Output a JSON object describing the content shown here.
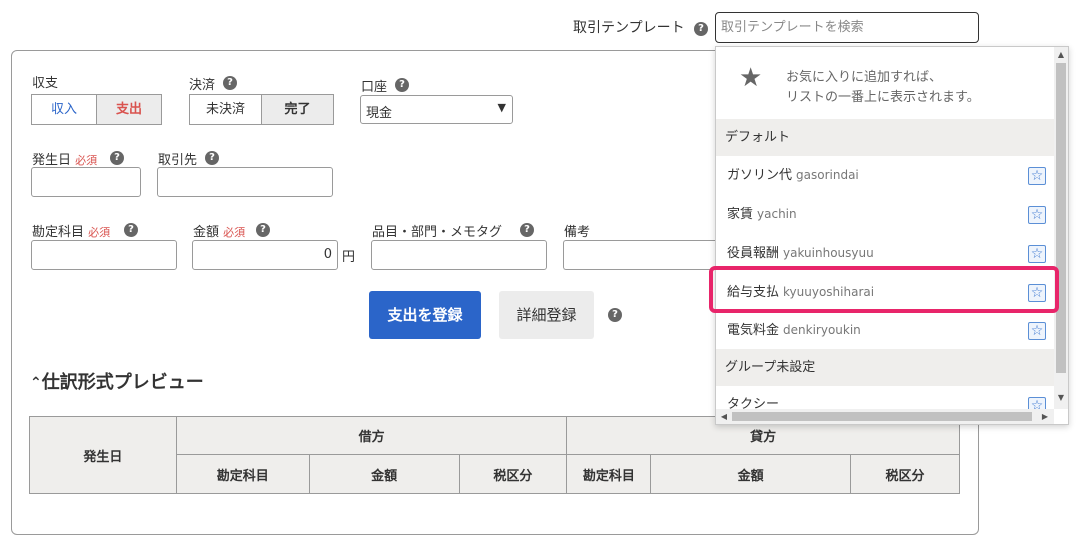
{
  "template": {
    "label": "取引テンプレート",
    "search_placeholder": "取引テンプレートを検索",
    "dropdown": {
      "hint_line1": "お気に入りに追加すれば、",
      "hint_line2": "リストの一番上に表示されます。",
      "groups": [
        {
          "name": "デフォルト",
          "items": [
            {
              "name": "ガソリン代",
              "roma": "gasorindai"
            },
            {
              "name": "家賃",
              "roma": "yachin"
            },
            {
              "name": "役員報酬",
              "roma": "yakuinhousyuu"
            },
            {
              "name": "給与支払",
              "roma": "kyuuyoshiharai"
            },
            {
              "name": "電気料金",
              "roma": "denkiryoukin"
            }
          ]
        },
        {
          "name": "グループ未設定",
          "items": [
            {
              "name": "タクシー",
              "roma": ""
            }
          ]
        }
      ],
      "highlight_color": "#e8256a"
    }
  },
  "form": {
    "shushi": {
      "label": "収支",
      "options": [
        "収入",
        "支出"
      ],
      "selected": "支出"
    },
    "kessai": {
      "label": "決済",
      "options": [
        "未決済",
        "完了"
      ],
      "selected": "完了"
    },
    "account": {
      "label": "口座",
      "value": "現金"
    },
    "date": {
      "label": "発生日",
      "required": "必須"
    },
    "partner": {
      "label": "取引先"
    },
    "subject": {
      "label": "勘定科目",
      "required": "必須"
    },
    "amount": {
      "label": "金額",
      "required": "必須",
      "value": "0",
      "unit": "円"
    },
    "tags": {
      "label": "品目・部門・メモタグ"
    },
    "memo": {
      "label": "備考"
    },
    "register_button": "支出を登録",
    "detail_button": "詳細登録"
  },
  "preview": {
    "title": "仕訳形式プレビュー",
    "date_header": "発生日",
    "debit_header": "借方",
    "credit_header": "貸方",
    "sub_headers": [
      "勘定科目",
      "金額",
      "税区分"
    ]
  },
  "colors": {
    "primary": "#2b65c9",
    "expense_red": "#d9534f",
    "income_blue": "#2b65c9",
    "required_red": "#d9534f"
  }
}
